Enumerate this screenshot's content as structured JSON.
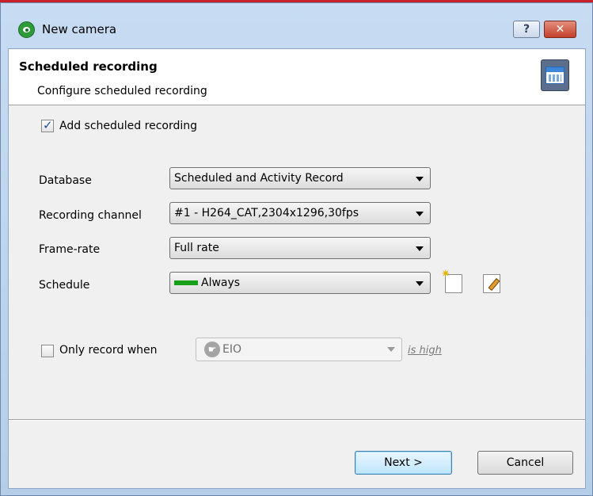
{
  "window": {
    "title": "New camera",
    "help_glyph": "?",
    "close_glyph": "✕",
    "accent_red": "#c8202a"
  },
  "header": {
    "title": "Scheduled recording",
    "subtitle": "Configure scheduled recording",
    "icon": "calendar-film-icon"
  },
  "form": {
    "add_scheduled_label": "Add scheduled recording",
    "add_scheduled_checked": true,
    "database_label": "Database",
    "database_value": "Scheduled and Activity Record",
    "channel_label": "Recording channel",
    "channel_value": "#1 - H264_CAT,2304x1296,30fps",
    "framerate_label": "Frame-rate",
    "framerate_value": "Full rate",
    "schedule_label": "Schedule",
    "schedule_value": "Always",
    "schedule_color": "#18a018",
    "only_record_label": "Only record when",
    "only_record_checked": false,
    "trigger_value": "EIO",
    "trigger_condition": "is high"
  },
  "buttons": {
    "next_label": "Next >",
    "cancel_label": "Cancel"
  }
}
